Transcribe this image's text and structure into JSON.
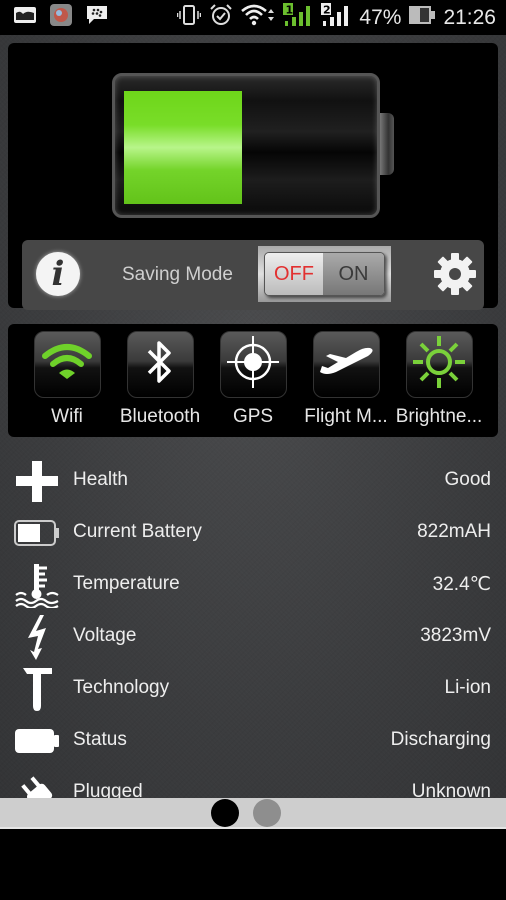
{
  "status_bar": {
    "left_icons": [
      "gallery-icon",
      "app-thumbnail-icon",
      "bbm-icon"
    ],
    "right_icons": [
      "vibrate-icon",
      "alarm-icon",
      "wifi-icon",
      "sim1-signal-icon",
      "sim2-signal-icon"
    ],
    "battery_percent": "47%",
    "time": "21:26"
  },
  "battery": {
    "level_fraction": 0.47,
    "fill_color": "#6ed61a"
  },
  "control_bar": {
    "info_icon": "info-icon",
    "saving_mode_label": "Saving Mode",
    "toggle_off_label": "OFF",
    "toggle_on_label": "ON",
    "toggle_state": "off",
    "settings_icon": "gear-icon"
  },
  "quick_toggles": [
    {
      "icon": "wifi-icon",
      "label": "Wifi",
      "active": true
    },
    {
      "icon": "bluetooth-icon",
      "label": "Bluetooth",
      "active": false
    },
    {
      "icon": "gps-icon",
      "label": "GPS",
      "active": false
    },
    {
      "icon": "airplane-icon",
      "label": "Flight M...",
      "active": false
    },
    {
      "icon": "brightness-icon",
      "label": "Brightne...",
      "active": true
    }
  ],
  "stats": [
    {
      "icon": "health-cross-icon",
      "label": "Health",
      "value": "Good"
    },
    {
      "icon": "battery-icon",
      "label": "Current Battery",
      "value": "822mAH"
    },
    {
      "icon": "temperature-icon",
      "label": "Temperature",
      "value": "32.4℃"
    },
    {
      "icon": "voltage-bolt-icon",
      "label": "Voltage",
      "value": "3823mV"
    },
    {
      "icon": "hammer-icon",
      "label": "Technology",
      "value": "Li-ion"
    },
    {
      "icon": "battery-status-icon",
      "label": "Status",
      "value": "Discharging"
    },
    {
      "icon": "plug-icon",
      "label": "Plugged",
      "value": "Unknown"
    }
  ],
  "pager": {
    "pages": 2,
    "current": 1
  },
  "colors": {
    "accent_green": "#6ed61a",
    "off_red": "#e23030"
  }
}
